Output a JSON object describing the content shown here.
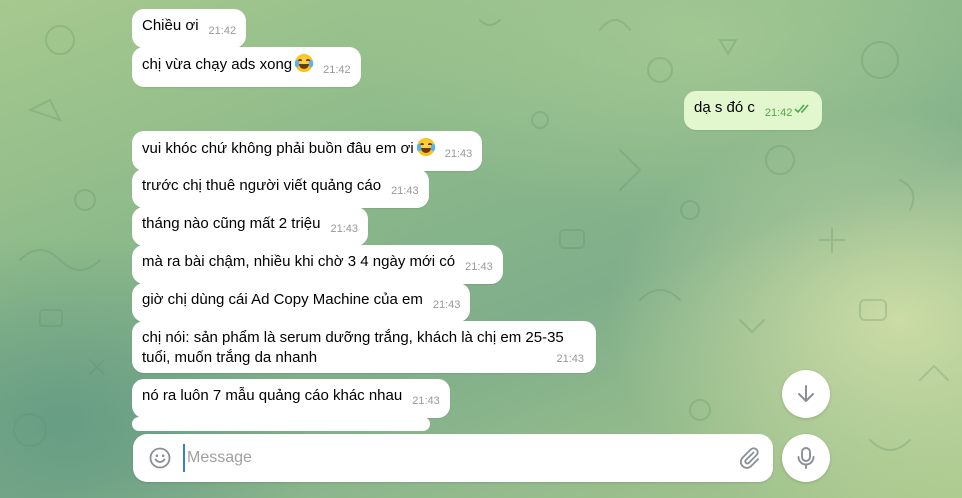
{
  "messages": [
    {
      "text": "Chiều ơi",
      "time": "21:42",
      "direction": "in"
    },
    {
      "text": "chị vừa chạy ads xong",
      "emoji": "crying-laughing",
      "time": "21:42",
      "direction": "in"
    },
    {
      "text": "dạ s đó c",
      "time": "21:42",
      "direction": "out",
      "status": "read"
    },
    {
      "text": "vui khóc chứ không phải buồn đâu em ơi",
      "emoji": "crying-laughing",
      "time": "21:43",
      "direction": "in"
    },
    {
      "text": "trước chị thuê người viết quảng cáo",
      "time": "21:43",
      "direction": "in"
    },
    {
      "text": "tháng nào cũng mất 2 triệu",
      "time": "21:43",
      "direction": "in"
    },
    {
      "text": "mà ra bài chậm, nhiều khi chờ 3 4 ngày mới có",
      "time": "21:43",
      "direction": "in"
    },
    {
      "text": "giờ chị dùng cái Ad Copy Machine của em",
      "time": "21:43",
      "direction": "in"
    },
    {
      "text": "chị nói: sản phẩm là serum dưỡng trắng, khách là chị em 25-35 tuổi, muốn trắng da nhanh",
      "time": "21:43",
      "direction": "in"
    },
    {
      "text": "nó ra luôn 7 mẫu quảng cáo khác nhau",
      "time": "21:43",
      "direction": "in"
    }
  ],
  "composer": {
    "placeholder": "Message"
  },
  "icons": {
    "scroll_down": "arrow-down-icon",
    "emoji": "smile-icon",
    "attach": "paperclip-icon",
    "mic": "microphone-icon"
  },
  "colors": {
    "incoming_bubble": "#ffffff",
    "outgoing_bubble": "#e3f7ce",
    "outgoing_time": "#4ea84a",
    "caret": "#3a7bd5"
  }
}
